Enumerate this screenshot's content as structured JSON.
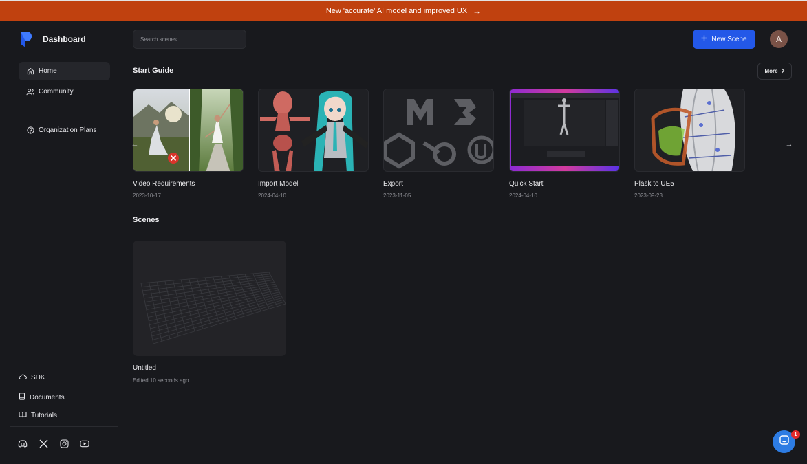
{
  "banner": {
    "text": "New 'accurate' AI model and improved UX",
    "arrow_icon": "arrow-right-icon"
  },
  "sidebar": {
    "brand": {
      "title": "Dashboard",
      "logo_icon": "plask-logo-icon",
      "color": "#2358e8"
    },
    "nav": [
      {
        "label": "Home",
        "icon": "home-icon",
        "active": true
      },
      {
        "label": "Community",
        "icon": "users-icon"
      },
      {
        "label": "Organization Plans",
        "icon": "question-circle-icon"
      }
    ],
    "bottom": [
      {
        "label": "SDK",
        "icon": "cloud-icon"
      },
      {
        "label": "Documents",
        "icon": "document-icon"
      },
      {
        "label": "Tutorials",
        "icon": "book-icon"
      }
    ],
    "socials": [
      "discord-icon",
      "x-icon",
      "instagram-icon",
      "youtube-icon"
    ]
  },
  "header": {
    "search_placeholder": "Search scenes...",
    "new_scene_label": "New Scene",
    "avatar_initial": "A"
  },
  "start_guide": {
    "title": "Start Guide",
    "more_label": "More",
    "cards": [
      {
        "title": "Video Requirements",
        "date": "2023-10-17"
      },
      {
        "title": "Import Model",
        "date": "2024-04-10"
      },
      {
        "title": "Export",
        "date": "2023-11-05"
      },
      {
        "title": "Quick Start",
        "date": "2024-04-10"
      },
      {
        "title": "Plask to UE5",
        "date": "2023-09-23"
      }
    ]
  },
  "scenes": {
    "title": "Scenes",
    "items": [
      {
        "title": "Untitled",
        "subtitle": "Edited 10 seconds ago"
      }
    ]
  },
  "chat": {
    "badge": "1"
  },
  "colors": {
    "background": "#18191d",
    "banner": "#c0410f",
    "accent": "#2358e8"
  }
}
